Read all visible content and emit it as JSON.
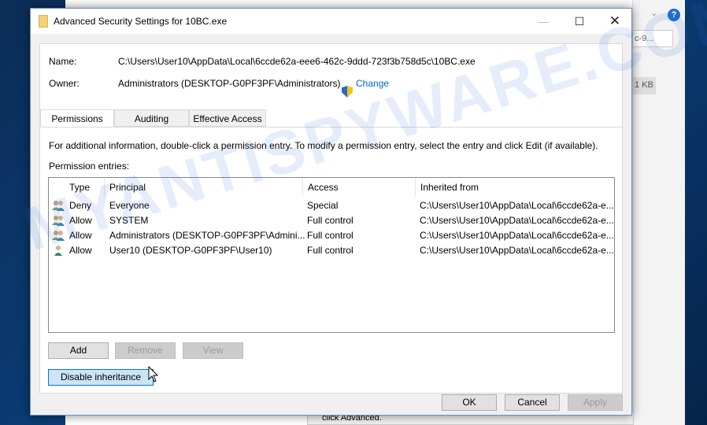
{
  "background": {
    "search_text": "c-9...",
    "size_badge": "1 KB",
    "bottom_text": "click Advanced."
  },
  "dialog": {
    "title": "Advanced Security Settings for 10BC.exe",
    "name_label": "Name:",
    "name_value": "C:\\Users\\User10\\AppData\\Local\\6ccde62a-eee6-462c-9ddd-723f3b758d5c\\10BC.exe",
    "owner_label": "Owner:",
    "owner_value": "Administrators (DESKTOP-G0PF3PF\\Administrators)",
    "change_link": "Change",
    "tabs": [
      {
        "label": "Permissions",
        "active": true
      },
      {
        "label": "Auditing"
      },
      {
        "label": "Effective Access"
      }
    ],
    "info_text": "For additional information, double-click a permission entry. To modify a permission entry, select the entry and click Edit (if available).",
    "entries_label": "Permission entries:",
    "columns": [
      "Type",
      "Principal",
      "Access",
      "Inherited from"
    ],
    "rows": [
      {
        "icon": "group-users-icon",
        "type": "Deny",
        "principal": "Everyone",
        "access": "Special",
        "inherited": "C:\\Users\\User10\\AppData\\Local\\6ccde62a-e..."
      },
      {
        "icon": "group-users-icon",
        "type": "Allow",
        "principal": "SYSTEM",
        "access": "Full control",
        "inherited": "C:\\Users\\User10\\AppData\\Local\\6ccde62a-e..."
      },
      {
        "icon": "group-users-icon",
        "type": "Allow",
        "principal": "Administrators (DESKTOP-G0PF3PF\\Admini...",
        "access": "Full control",
        "inherited": "C:\\Users\\User10\\AppData\\Local\\6ccde62a-e..."
      },
      {
        "icon": "user-icon",
        "type": "Allow",
        "principal": "User10 (DESKTOP-G0PF3PF\\User10)",
        "access": "Full control",
        "inherited": "C:\\Users\\User10\\AppData\\Local\\6ccde62a-e..."
      }
    ],
    "buttons": {
      "add": "Add",
      "remove": "Remove",
      "view": "View",
      "disable_inheritance": "Disable inheritance",
      "ok": "OK",
      "cancel": "Cancel",
      "apply": "Apply"
    }
  },
  "watermark": "MYANTISPYWARE.COM"
}
